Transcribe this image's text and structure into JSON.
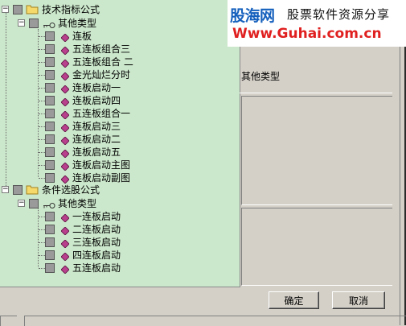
{
  "banner": {
    "title": "股海网",
    "subtitle": "股票软件资源分享",
    "url": "Www.Guhai.com.cn"
  },
  "tree": {
    "groups": [
      {
        "label": "技术指标公式",
        "subgroup": "其他类型",
        "items": [
          "连板",
          "五连板组合三",
          "五连板组合 二",
          "金光灿烂分时",
          "连板启动一",
          "连板启动四",
          "五连板组合一",
          "连板启动三",
          "连板启动二",
          "连板启动五",
          "连板启动主图",
          "连板启动副图"
        ]
      },
      {
        "label": "条件选股公式",
        "subgroup": "其他类型",
        "items": [
          "一连板启动",
          "二连板启动",
          "三连板启动",
          "四连板启动",
          "五连板启动"
        ]
      }
    ]
  },
  "detail": {
    "type_label": "其他类型"
  },
  "buttons": {
    "ok": "确定",
    "cancel": "取消"
  },
  "colors": {
    "tree_bg": "#cce8cc",
    "banner_blue": "#1560bd",
    "banner_red": "#e02020",
    "formula_icon": "#b8408c"
  },
  "icons": {
    "group": "folder-icon",
    "subgroup": "key-icon",
    "item": "formula-icon"
  }
}
